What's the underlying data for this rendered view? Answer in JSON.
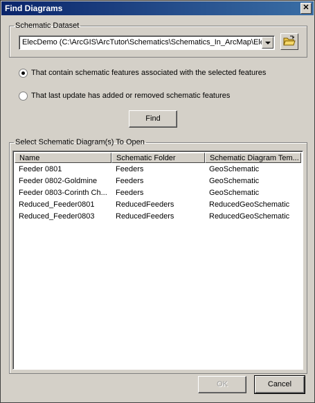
{
  "window": {
    "title": "Find Diagrams"
  },
  "dataset": {
    "legend": "Schematic Dataset",
    "selected_value": "ElecDemo (C:\\ArcGIS\\ArcTutor\\Schematics\\Schematics_In_ArcMap\\ElecD"
  },
  "options": [
    {
      "label": "That contain schematic features associated with the selected features",
      "checked": true
    },
    {
      "label": "That last update has added or removed schematic features",
      "checked": false
    }
  ],
  "find_button": "Find",
  "diagrams": {
    "legend": "Select Schematic Diagram(s) To Open",
    "columns": [
      "Name",
      "Schematic Folder",
      "Schematic Diagram Tem..."
    ],
    "rows": [
      [
        "Feeder 0801",
        "Feeders",
        "GeoSchematic"
      ],
      [
        "Feeder 0802-Goldmine",
        "Feeders",
        "GeoSchematic"
      ],
      [
        "Feeder 0803-Corinth Ch...",
        "Feeders",
        "GeoSchematic"
      ],
      [
        "Reduced_Feeder0801",
        "ReducedFeeders",
        "ReducedGeoSchematic"
      ],
      [
        "Reduced_Feeder0803",
        "ReducedFeeders",
        "ReducedGeoSchematic"
      ]
    ]
  },
  "footer": {
    "ok_label": "OK",
    "cancel_label": "Cancel"
  }
}
